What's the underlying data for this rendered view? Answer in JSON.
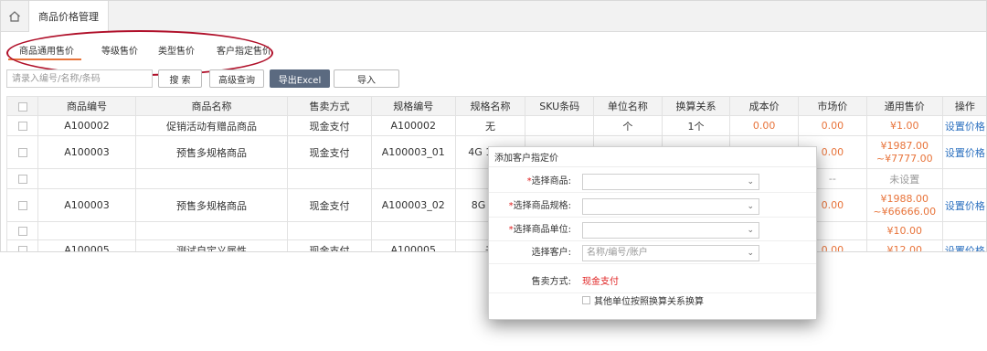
{
  "topbar": {
    "page_tab": "商品价格管理",
    "home_icon": "home-icon"
  },
  "subtabs": [
    {
      "label": "商品通用售价",
      "active": true
    },
    {
      "label": "等级售价",
      "active": false
    },
    {
      "label": "类型售价",
      "active": false
    },
    {
      "label": "客户指定售价",
      "active": false
    }
  ],
  "toolbar": {
    "search_placeholder": "请录入编号/名称/条码",
    "search_label": "搜 索",
    "advanced_label": "高级查询",
    "export_label": "导出Excel",
    "import_label": "导入"
  },
  "table": {
    "headers": [
      "商品编号",
      "商品名称",
      "售卖方式",
      "规格编号",
      "规格名称",
      "SKU条码",
      "单位名称",
      "换算关系",
      "成本价",
      "市场价",
      "通用售价",
      "操作"
    ],
    "rows": [
      {
        "code": "A100002",
        "name": "促销活动有赠品商品",
        "sale": "现金支付",
        "spec_code": "A100002",
        "spec_name": "无",
        "sku": "",
        "unit": "个",
        "ratio": "1个",
        "cost": "0.00",
        "market": "0.00",
        "price1": "¥1.00",
        "price2": "",
        "op": "设置价格"
      },
      {
        "code": "A100003",
        "name": "预售多规格商品",
        "sale": "现金支付",
        "spec_code": "A100003_01",
        "spec_name": "4G 128G",
        "sku": "",
        "unit": "",
        "ratio": "",
        "cost": "",
        "market": "0.00",
        "price1": "¥1987.00",
        "price2": "~¥7777.00",
        "op": "设置价格"
      },
      {
        "code": "",
        "name": "",
        "sale": "",
        "spec_code": "",
        "spec_name": "",
        "sku": "",
        "unit": "",
        "ratio": "",
        "cost": "",
        "market": "--",
        "price1": "未设置",
        "price2": "",
        "op": ""
      },
      {
        "code": "A100003",
        "name": "预售多规格商品",
        "sale": "现金支付",
        "spec_code": "A100003_02",
        "spec_name": "8G 64G",
        "sku": "",
        "unit": "",
        "ratio": "",
        "cost": "",
        "market": "0.00",
        "price1": "¥1988.00",
        "price2": "~¥66666.00",
        "op": "设置价格"
      },
      {
        "code": "",
        "name": "",
        "sale": "",
        "spec_code": "",
        "spec_name": "",
        "sku": "",
        "unit": "",
        "ratio": "",
        "cost": "",
        "market": "",
        "price1": "¥10.00",
        "price2": "",
        "op": ""
      },
      {
        "code": "A100005",
        "name": "测试自定义属性",
        "sale": "现金支付",
        "spec_code": "A100005",
        "spec_name": "无",
        "sku": "",
        "unit": "",
        "ratio": "",
        "cost": "",
        "market": "0.00",
        "price1": "¥12.00",
        "price2": "",
        "op": "设置价格"
      }
    ]
  },
  "modal": {
    "title": "添加客户指定价",
    "select_product_label": "选择商品:",
    "select_spec_label": "选择商品规格:",
    "select_unit_label": "选择商品单位:",
    "select_customer_label": "选择客户:",
    "customer_placeholder": "名称/编号/账户",
    "sale_method_label": "售卖方式:",
    "sale_method_value": "现金支付",
    "other_units_label": "其他单位按照换算关系换算"
  },
  "colors": {
    "accent_orange": "#e8743b",
    "link_blue": "#2a6fbf",
    "required_red": "#e02020",
    "annotation_red": "#b0102a",
    "primary_button": "#5b6a80"
  }
}
